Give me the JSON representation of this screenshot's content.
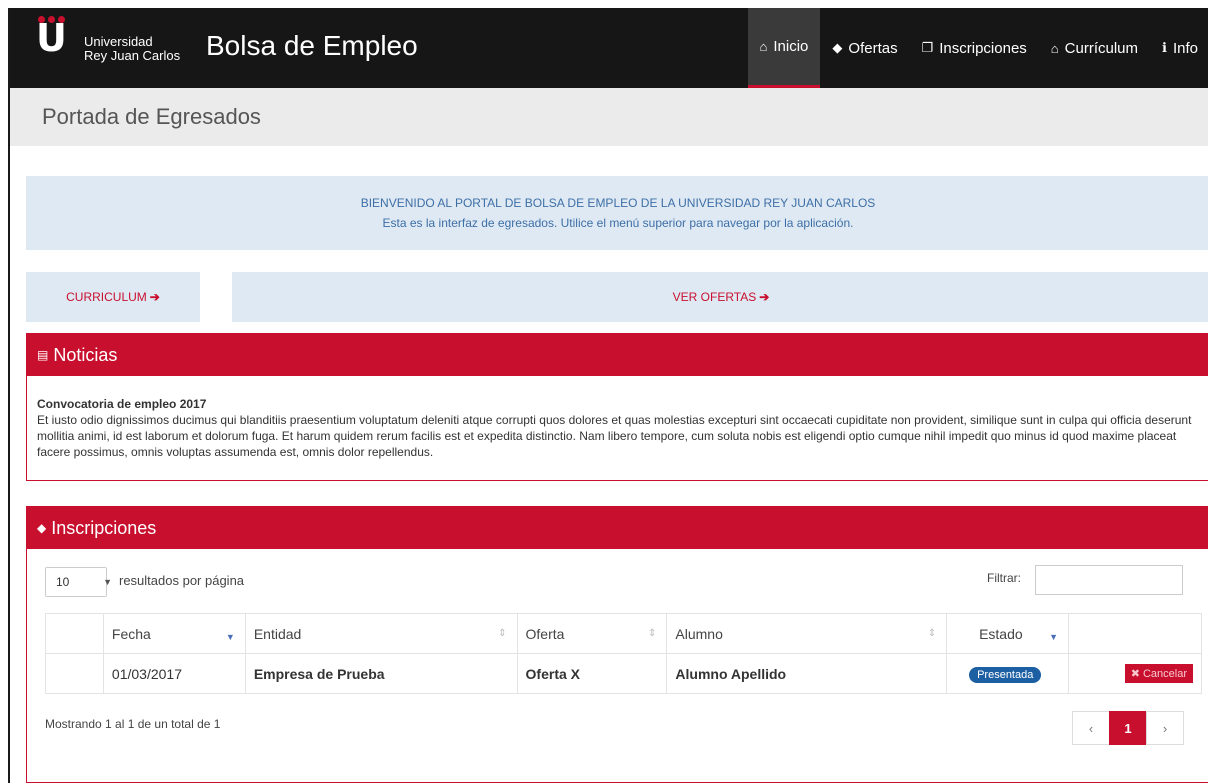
{
  "header": {
    "university": [
      "Universidad",
      "Rey Juan Carlos"
    ],
    "brand_title": "Bolsa de Empleo",
    "nav": [
      {
        "label": "Inicio",
        "icon": "home-icon",
        "glyph": "⌂"
      },
      {
        "label": "Ofertas",
        "icon": "tag-icon",
        "glyph": "◆"
      },
      {
        "label": "Inscripciones",
        "icon": "copy-icon",
        "glyph": "❐"
      },
      {
        "label": "Currículum",
        "icon": "home-icon",
        "glyph": "⌂"
      },
      {
        "label": "Info",
        "icon": "info-icon",
        "glyph": "ℹ"
      }
    ]
  },
  "page": {
    "title": "Portada de Egresados"
  },
  "welcome": {
    "line1": "BIENVENIDO AL PORTAL DE BOLSA DE EMPLEO DE LA UNIVERSIDAD REY JUAN CARLOS",
    "line2": "Esta es la interfaz de egresados. Utilice el menú superior para navegar por la aplicación."
  },
  "cta": {
    "curriculum": "CURRICULUM",
    "ofertas": "VER OFERTAS"
  },
  "news": {
    "heading": "Noticias",
    "item_title": "Convocatoria de empleo 2017",
    "item_body": "Et iusto odio dignissimos ducimus qui blanditiis praesentium voluptatum deleniti atque corrupti quos dolores et quas molestias excepturi sint occaecati cupiditate non provident, similique sunt in culpa qui officia deserunt mollitia animi, id est laborum et dolorum fuga. Et harum quidem rerum facilis est et expedita distinctio. Nam libero tempore, cum soluta nobis est eligendi optio cumque nihil impedit quo minus id quod maxime placeat facere possimus, omnis voluptas assumenda est, omnis dolor repellendus."
  },
  "inscripciones": {
    "heading": "Inscripciones",
    "page_length": "10",
    "length_label": "resultados por página",
    "filter_label": "Filtrar:",
    "columns": [
      "Fecha",
      "Entidad",
      "Oferta",
      "Alumno",
      "Estado"
    ],
    "rows": [
      {
        "fecha": "01/03/2017",
        "entidad": "Empresa de Prueba",
        "oferta": "Oferta X",
        "alumno": "Alumno Apellido",
        "estado": "Presentada",
        "action": "Cancelar"
      }
    ],
    "info": "Mostrando 1 al 1 de un total de 1",
    "pager": {
      "prev": "‹",
      "current": "1",
      "next": "›"
    }
  },
  "colors": {
    "accent": "#c8102e",
    "navbar": "#161616",
    "info_bg": "#dfe9f4",
    "badge": "#1d5fa3"
  }
}
